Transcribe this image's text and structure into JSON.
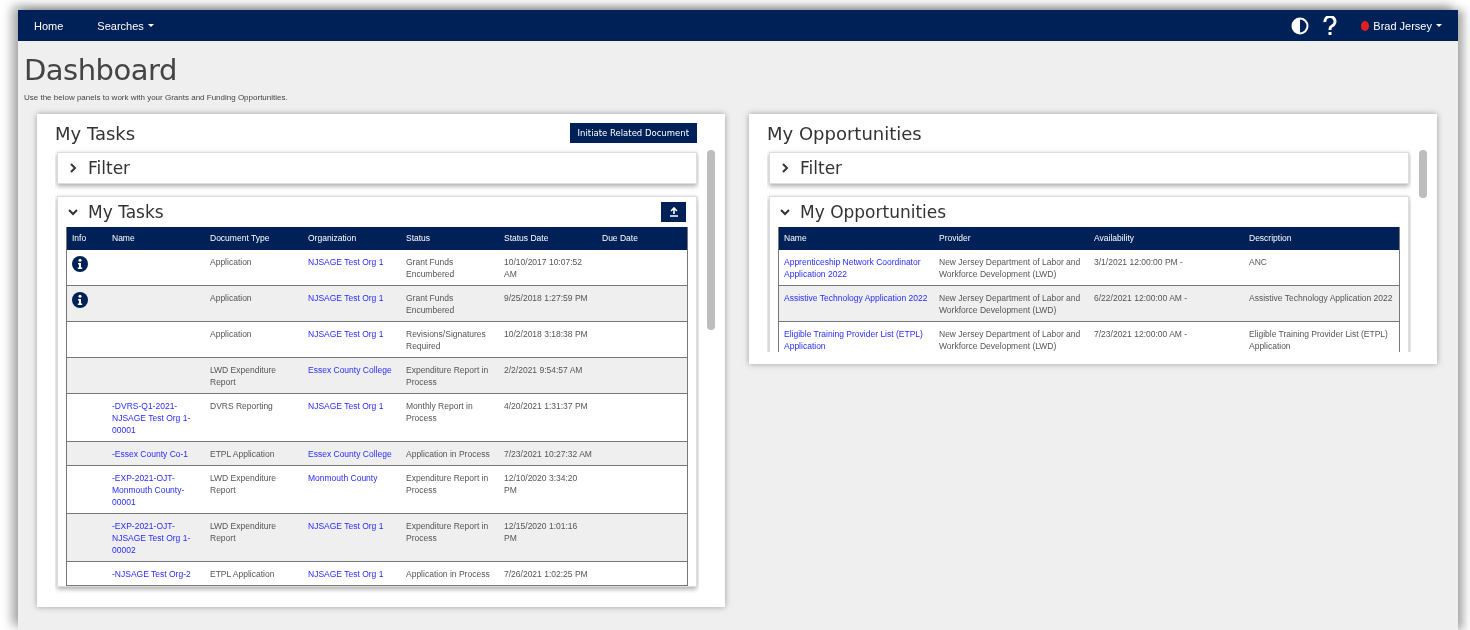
{
  "nav": {
    "items": [
      {
        "label": "Home",
        "dropdown": false
      },
      {
        "label": "Searches",
        "dropdown": true
      }
    ],
    "user": {
      "name": "Brad Jersey",
      "online": true
    }
  },
  "page": {
    "title": "Dashboard",
    "subtitle": "Use the below panels to work with your Grants and Funding Opportunities."
  },
  "tasks_panel": {
    "title": "My Tasks",
    "action_button": "Initiate Related Document",
    "filter": {
      "label": "Filter",
      "expanded": false
    },
    "section": {
      "label": "My Tasks",
      "expanded": true
    },
    "table": {
      "columns": [
        "Info",
        "Name",
        "Document Type",
        "Organization",
        "Status",
        "Status Date",
        "Due Date"
      ],
      "rows": [
        {
          "info": true,
          "name": "",
          "document_type": "Application",
          "organization": "NJSAGE Test Org 1",
          "status": "Grant Funds Encumbered",
          "status_date": "10/10/2017 10:07:52 AM"
        },
        {
          "info": true,
          "name": "",
          "document_type": "Application",
          "organization": "NJSAGE Test Org 1",
          "status": "Grant Funds Encumbered",
          "status_date": "9/25/2018 1:27:59 PM"
        },
        {
          "info": false,
          "name": "",
          "document_type": "Application",
          "organization": "NJSAGE Test Org 1",
          "status": "Revisions/Signatures Required",
          "status_date": "10/2/2018 3:18:38 PM"
        },
        {
          "info": false,
          "name": "",
          "document_type": "LWD Expenditure Report",
          "organization": "Essex County College",
          "status": "Expenditure Report in Process",
          "status_date": "2/2/2021 9:54:57 AM"
        },
        {
          "info": false,
          "name": "-DVRS-Q1-2021-NJSAGE Test Org 1-00001",
          "document_type": "DVRS Reporting",
          "organization": "NJSAGE Test Org 1",
          "status": "Monthly Report in Process",
          "status_date": "4/20/2021 1:31:37 PM"
        },
        {
          "info": false,
          "name": "-Essex County Co-1",
          "document_type": "ETPL Application",
          "organization": "Essex County College",
          "status": "Application in Process",
          "status_date": "7/23/2021 10:27:32 AM"
        },
        {
          "info": false,
          "name": "-EXP-2021-OJT-Monmouth County-00001",
          "document_type": "LWD Expenditure Report",
          "organization": "Monmouth County",
          "status": "Expenditure Report in Process",
          "status_date": "12/10/2020 3:34:20 PM"
        },
        {
          "info": false,
          "name": "-EXP-2021-OJT-NJSAGE Test Org 1-00002",
          "document_type": "LWD Expenditure Report",
          "organization": "NJSAGE Test Org 1",
          "status": "Expenditure Report in Process",
          "status_date": "12/15/2020 1:01:16 PM"
        },
        {
          "info": false,
          "name": "-NJSAGE Test Org-2",
          "document_type": "ETPL Application",
          "organization": "NJSAGE Test Org 1",
          "status": "Application in Process",
          "status_date": "7/26/2021 1:02:25 PM"
        }
      ]
    }
  },
  "opportunities_panel": {
    "title": "My Opportunities",
    "filter": {
      "label": "Filter",
      "expanded": false
    },
    "section": {
      "label": "My Opportunities",
      "expanded": true
    },
    "table": {
      "columns": [
        "Name",
        "Provider",
        "Availability",
        "Description"
      ],
      "rows": [
        {
          "name": "Apprenticeship Network Coordinator Application 2022",
          "provider": "New Jersey Department of Labor and Workforce Development (LWD)",
          "availability": "3/1/2021 12:00:00 PM -",
          "description": "ANC"
        },
        {
          "name": "Assistive Technology Application 2022",
          "provider": "New Jersey Department of Labor and Workforce Development (LWD)",
          "availability": "6/22/2021 12:00:00 AM -",
          "description": "Assistive Technology Application 2022"
        },
        {
          "name": "Eligible Training Provider List (ETPL) Application",
          "provider": "New Jersey Department of Labor and Workforce Development (LWD)",
          "availability": "7/23/2021 12:00:00 AM -",
          "description": "Eligible Training Provider List (ETPL) Application"
        }
      ]
    }
  }
}
